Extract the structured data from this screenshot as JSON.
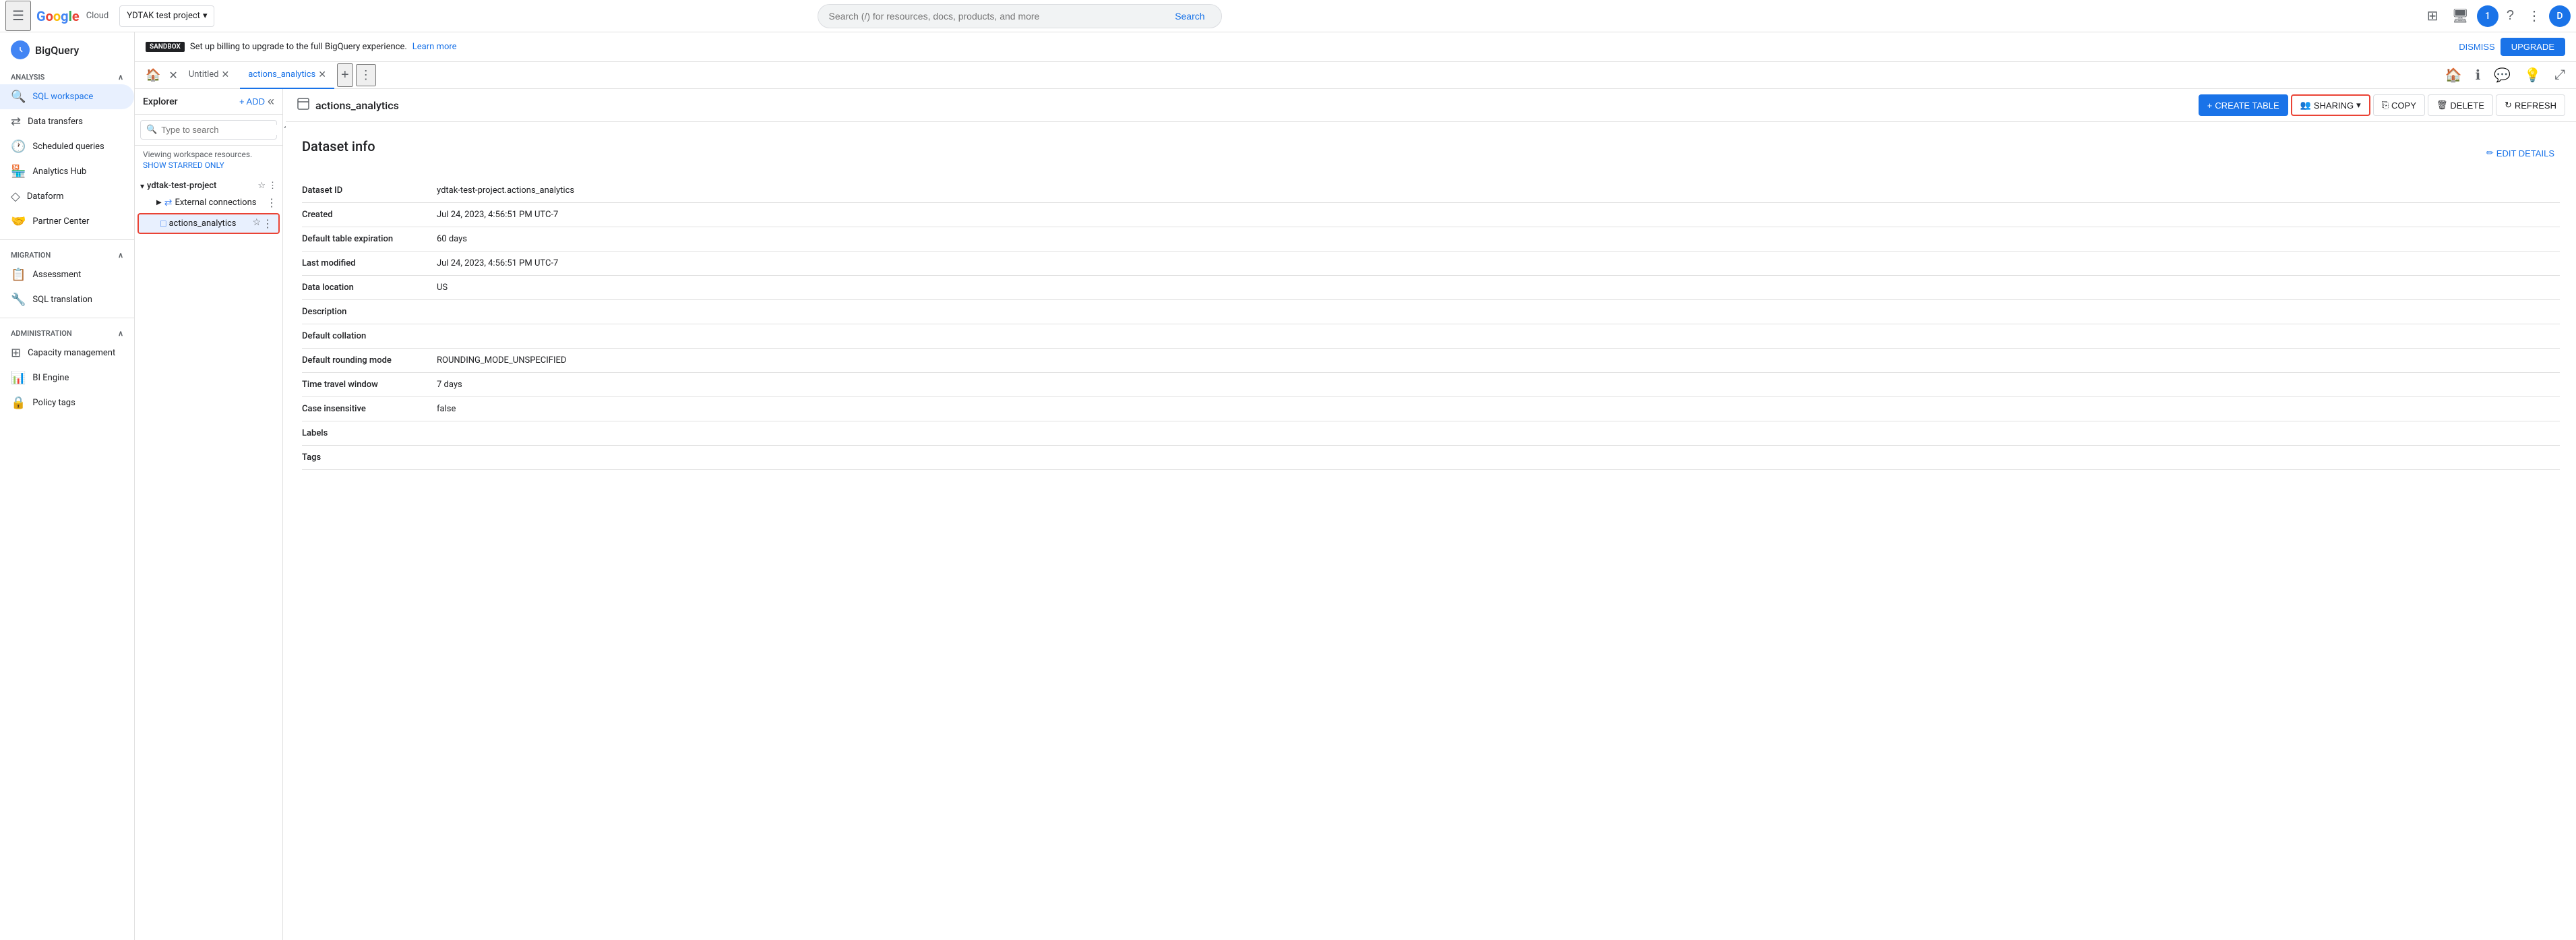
{
  "topNav": {
    "menuIcon": "☰",
    "logoText": "Google Cloud",
    "project": {
      "name": "YDTAK test project",
      "dropdownIcon": "▾"
    },
    "search": {
      "placeholder": "Search (/) for resources, docs, products, and more",
      "buttonLabel": "Search"
    },
    "rightIcons": [
      "⊞",
      "🖥",
      "1",
      "?",
      "⋮",
      "D"
    ]
  },
  "sidebar": {
    "appName": "BigQuery",
    "sections": [
      {
        "label": "Analysis",
        "collapsible": true,
        "items": [
          {
            "id": "sql-workspace",
            "label": "SQL workspace",
            "icon": "🔍",
            "active": true
          },
          {
            "id": "data-transfers",
            "label": "Data transfers",
            "icon": "⇄"
          },
          {
            "id": "scheduled-queries",
            "label": "Scheduled queries",
            "icon": "🕐"
          },
          {
            "id": "analytics-hub",
            "label": "Analytics Hub",
            "icon": "🏪"
          },
          {
            "id": "dataform",
            "label": "Dataform",
            "icon": "◇"
          },
          {
            "id": "partner-center",
            "label": "Partner Center",
            "icon": "🤝"
          }
        ]
      },
      {
        "label": "Migration",
        "collapsible": true,
        "items": [
          {
            "id": "assessment",
            "label": "Assessment",
            "icon": "📋"
          },
          {
            "id": "sql-translation",
            "label": "SQL translation",
            "icon": "🔧"
          }
        ]
      },
      {
        "label": "Administration",
        "collapsible": true,
        "items": [
          {
            "id": "capacity-management",
            "label": "Capacity management",
            "icon": "⊞"
          },
          {
            "id": "bi-engine",
            "label": "BI Engine",
            "icon": "📊"
          },
          {
            "id": "policy-tags",
            "label": "Policy tags",
            "icon": "🔒"
          }
        ]
      }
    ]
  },
  "sandboxBanner": {
    "badgeText": "SANDBOX",
    "message": "Set up billing to upgrade to the full BigQuery experience.",
    "learnMoreText": "Learn more",
    "dismissText": "DISMISS",
    "upgradeText": "UPGRADE"
  },
  "tabs": {
    "homeIcon": "🏠",
    "items": [
      {
        "id": "untitled",
        "label": "Untitled",
        "active": false,
        "closeable": true
      },
      {
        "id": "actions-analytics",
        "label": "actions_analytics",
        "active": true,
        "closeable": true
      }
    ],
    "addIcon": "+",
    "moreIcon": "⋮"
  },
  "explorer": {
    "title": "Explorer",
    "addLabel": "+ ADD",
    "collapseIcon": "«",
    "searchPlaceholder": "Type to search",
    "workspaceText": "Viewing workspace resources.",
    "showStarredText": "SHOW STARRED ONLY",
    "project": {
      "name": "ydtak-test-project",
      "expanded": true,
      "items": [
        {
          "id": "external-connections",
          "label": "External connections",
          "icon": "⇄",
          "expanded": false,
          "indent": 1
        },
        {
          "id": "actions-analytics",
          "label": "actions_analytics",
          "icon": "□",
          "selected": true,
          "indent": 1
        }
      ]
    }
  },
  "datasetInfo": {
    "icon": "□",
    "name": "actions_analytics",
    "toolbar": {
      "createTableLabel": "CREATE TABLE",
      "sharingLabel": "SHARING",
      "copyLabel": "COPY",
      "deleteLabel": "DELETE",
      "refreshLabel": "REFRESH"
    },
    "editDetailsLabel": "EDIT DETAILS",
    "infoTitle": "Dataset info",
    "fields": [
      {
        "label": "Dataset ID",
        "value": "ydtak-test-project.actions_analytics"
      },
      {
        "label": "Created",
        "value": "Jul 24, 2023, 4:56:51 PM UTC-7"
      },
      {
        "label": "Default table expiration",
        "value": "60 days"
      },
      {
        "label": "Last modified",
        "value": "Jul 24, 2023, 4:56:51 PM UTC-7"
      },
      {
        "label": "Data location",
        "value": "US"
      },
      {
        "label": "Description",
        "value": ""
      },
      {
        "label": "Default collation",
        "value": ""
      },
      {
        "label": "Default rounding mode",
        "value": "ROUNDING_MODE_UNSPECIFIED"
      },
      {
        "label": "Time travel window",
        "value": "7 days"
      },
      {
        "label": "Case insensitive",
        "value": "false"
      },
      {
        "label": "Labels",
        "value": ""
      },
      {
        "label": "Tags",
        "value": ""
      }
    ]
  }
}
